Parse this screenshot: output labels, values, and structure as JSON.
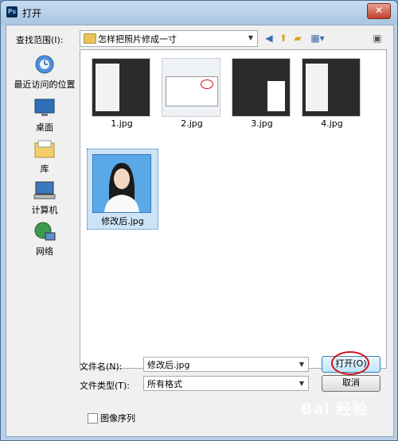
{
  "window": {
    "app_icon_text": "Ps",
    "title": "打开",
    "close_glyph": "✕"
  },
  "toolbar": {
    "look_in_label": "查找范围(I):",
    "current_folder": "怎样把照片修成一寸",
    "icons": [
      "back-icon",
      "up-folder-icon",
      "new-folder-icon",
      "view-menu-icon"
    ]
  },
  "sidebar": {
    "items": [
      {
        "label": "最近访问的位置",
        "icon": "recent-places-icon"
      },
      {
        "label": "桌面",
        "icon": "desktop-icon"
      },
      {
        "label": "库",
        "icon": "library-icon"
      },
      {
        "label": "计算机",
        "icon": "computer-icon"
      },
      {
        "label": "网络",
        "icon": "network-icon"
      }
    ]
  },
  "files": [
    {
      "name": "1.jpg",
      "selected": false
    },
    {
      "name": "2.jpg",
      "selected": false
    },
    {
      "name": "3.jpg",
      "selected": false
    },
    {
      "name": "4.jpg",
      "selected": false
    },
    {
      "name": "修改后.jpg",
      "selected": true
    }
  ],
  "filename": {
    "label": "文件名(N):",
    "value": "修改后.jpg"
  },
  "filetype": {
    "label": "文件类型(T):",
    "value": "所有格式"
  },
  "buttons": {
    "open": "打开(O)",
    "cancel": "取消"
  },
  "image_sequence": {
    "label": "图像序列",
    "checked": false
  },
  "watermark": "Bai 经验",
  "colors": {
    "selection": "#cde4f7",
    "highlight_circle": "#d4141c",
    "title_bar": "#c9dcef"
  }
}
